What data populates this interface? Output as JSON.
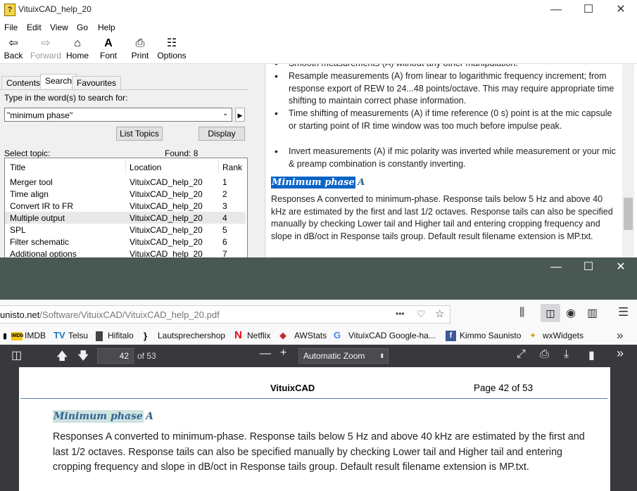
{
  "help_window": {
    "title": "VituixCAD_help_20",
    "window_controls": {
      "minimize": "—",
      "maximize": "☐",
      "close": "✕"
    },
    "menu": [
      "File",
      "Edit",
      "View",
      "Go",
      "Help"
    ],
    "toolbar": [
      {
        "label": "Back",
        "icon": "back-arrow-icon",
        "enabled": true
      },
      {
        "label": "Forward",
        "icon": "forward-arrow-icon",
        "enabled": false
      },
      {
        "label": "Home",
        "icon": "home-icon",
        "enabled": true
      },
      {
        "label": "Font",
        "icon": "font-icon",
        "enabled": true
      },
      {
        "label": "Print",
        "icon": "printer-icon",
        "enabled": true
      },
      {
        "label": "Options",
        "icon": "options-icon",
        "enabled": true
      }
    ],
    "tabs": [
      "Contents",
      "Search",
      "Favourites"
    ],
    "active_tab": "Search",
    "search": {
      "prompt": "Type in the word(s) to search for:",
      "value": "\"minimum phase\"",
      "list_topics_label": "List Topics",
      "display_label": "Display",
      "select_topic_label": "Select topic:",
      "found_label": "Found: 8"
    },
    "results": {
      "columns": [
        "Title",
        "Location",
        "Rank"
      ],
      "rows": [
        {
          "title": "Merger tool",
          "location": "VituixCAD_help_20",
          "rank": "1"
        },
        {
          "title": "Time align",
          "location": "VituixCAD_help_20",
          "rank": "2"
        },
        {
          "title": "Convert IR to FR",
          "location": "VituixCAD_help_20",
          "rank": "3"
        },
        {
          "title": "Multiple output",
          "location": "VituixCAD_help_20",
          "rank": "4"
        },
        {
          "title": "SPL",
          "location": "VituixCAD_help_20",
          "rank": "5"
        },
        {
          "title": "Filter schematic",
          "location": "VituixCAD_help_20",
          "rank": "6"
        },
        {
          "title": "Additional options",
          "location": "VituixCAD_help_20",
          "rank": "7"
        }
      ],
      "selected_index": 3
    },
    "content": {
      "bullet_top_partial": "Smooth measurements (A) without any other manipulation.",
      "bullets": [
        "Resample measurements (A) from linear to logarithmic frequency increment; from response export of REW to 24...48 points/octave. This may require appropriate time shifting to maintain correct phase information.",
        "Time shifting of measurements (A) if time reference (0 s) point is at the mic capsule or starting point of IR time window was too much before impulse peak.",
        "Invert measurements (A) if mic polarity was inverted while measurement or your mic & preamp combination is constantly inverting."
      ],
      "heading": "Minimum phase",
      "heading_suffix": "A",
      "paragraph": "Responses A converted to minimum-phase. Response tails below 5 Hz and above 40 kHz are estimated by the first and last 1/2 octaves. Response tails can also be specified manually by checking Lower tail and Higher tail and entering cropping frequency and slope in dB/oct in Response tails group. Default result filename extension is MP.txt."
    }
  },
  "firefox": {
    "window_controls": {
      "minimize": "—",
      "maximize": "☐",
      "close": "✕"
    },
    "url_domain": "unisto.net",
    "url_path": "/Software/VituixCAD/VituixCAD_help_20.pdf",
    "url_more": "•••",
    "bookmarks": [
      "IMDB",
      "Telsu",
      "Hifitalo",
      "Lautsprechershop",
      "Netflix",
      "AWStats",
      "VituixCAD Google-ha...",
      "Kimmo Saunisto",
      "wxWidgets"
    ],
    "pdf": {
      "page_number": "42",
      "page_count": "of 53",
      "zoom": "Automatic Zoom",
      "header_left": "VituixCAD",
      "header_right": "Page 42 of 53",
      "heading": "Minimum phase",
      "heading_suffix": "A",
      "paragraph": "Responses A converted to minimum-phase. Response tails below 5 Hz and above 40 kHz are estimated by the first and last 1/2 octaves. Response tails can also be specified manually by checking Lower tail and Higher tail and entering cropping frequency and slope in dB/oct in Response tails group. Default result filename extension is MP.txt."
    }
  },
  "colors": {
    "ff_titlebar": "#495852",
    "pdf_toolbar": "#38383d",
    "help_highlight": "#0a64c8",
    "pdf_heading": "#2f6490"
  }
}
